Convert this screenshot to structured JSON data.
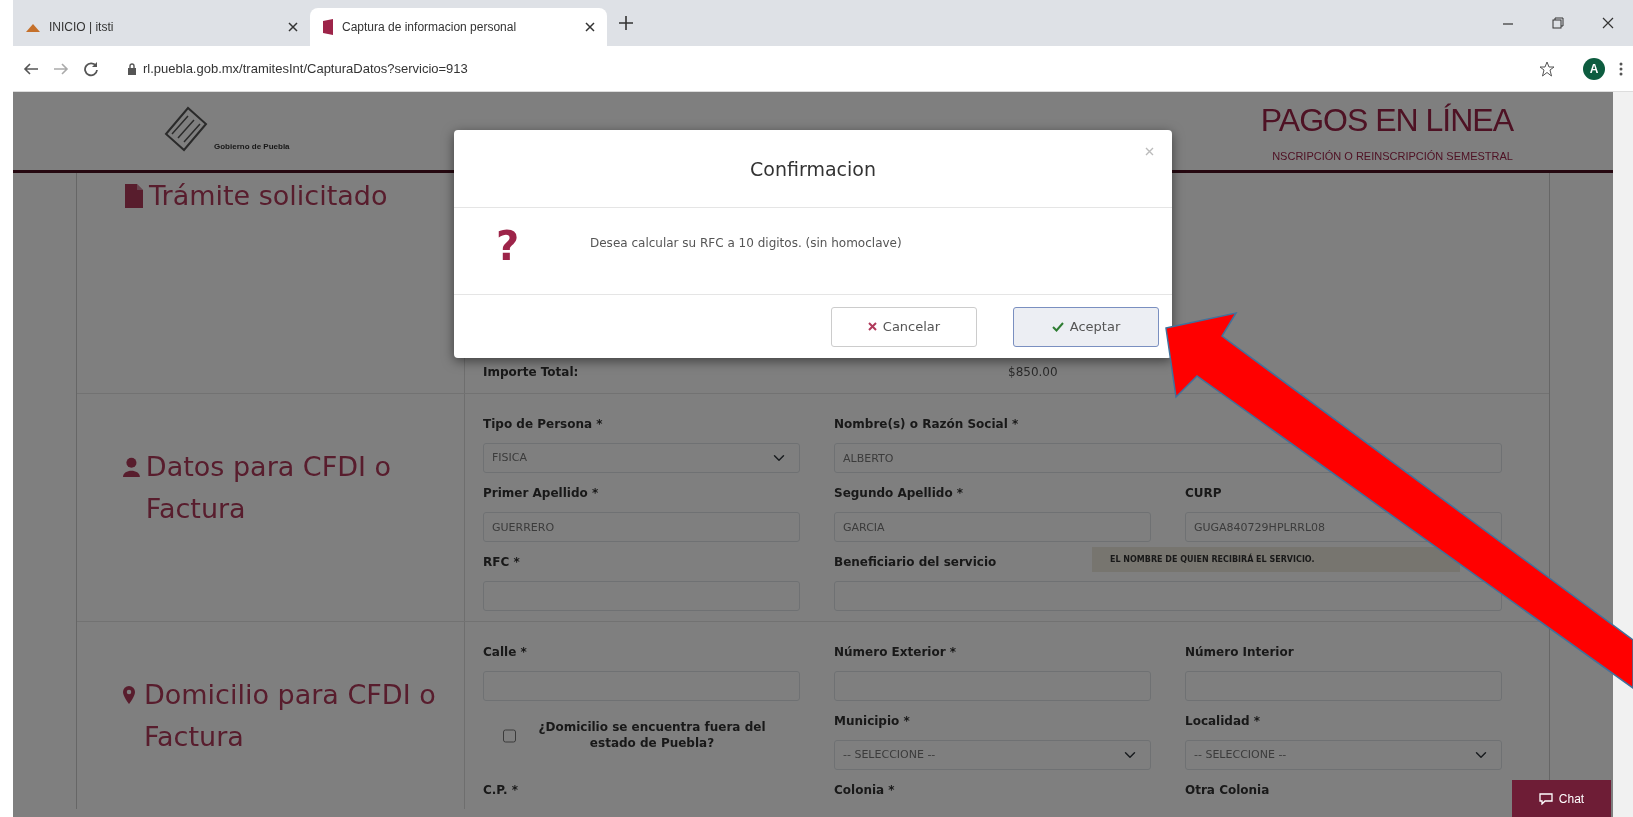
{
  "browser": {
    "tabs": [
      {
        "title": "INICIO | itsti",
        "selected": false
      },
      {
        "title": "Captura de informacion personal",
        "selected": true
      }
    ],
    "url": "rl.puebla.gob.mx/tramitesInt/CapturaDatos?servicio=913",
    "profile_initial": "A"
  },
  "header": {
    "logo_text": "Gobierno de Puebla",
    "title": "PAGOS EN LÍNEA",
    "subtitle": "NSCRIPCIÓN O REINSCRIPCIÓN SEMESTRAL"
  },
  "sections": [
    {
      "kind": "summary",
      "heading": "Trámite solicitado",
      "label": "Importe Total:",
      "value": "$850.00"
    },
    {
      "kind": "form",
      "heading": "Datos para CFDI o Factura",
      "rows": [
        [
          {
            "kind": "select",
            "label": "Tipo de Persona *",
            "value": "FISICA"
          },
          {
            "kind": "input",
            "label": "Nombre(s) o Razón Social *",
            "value": "ALBERTO",
            "wide": true
          }
        ],
        [
          {
            "kind": "input",
            "label": "Primer Apellido *",
            "value": "GUERRERO"
          },
          {
            "kind": "input",
            "label": "Segundo Apellido *",
            "value": "GARCIA"
          },
          {
            "kind": "input",
            "label": "CURP",
            "value": "GUGA840729HPLRRL08"
          }
        ],
        [
          {
            "kind": "input",
            "label": "RFC *"
          },
          {
            "kind": "input",
            "label": "Beneficiario del servicio",
            "wide": true,
            "hint": "EL NOMBRE DE QUIEN RECIBIRÁ EL SERVICIO."
          }
        ]
      ]
    },
    {
      "kind": "form",
      "heading": "Domicilio para CFDI o Factura",
      "rows": [
        [
          {
            "kind": "input",
            "label": "Calle *"
          },
          {
            "kind": "input",
            "label": "Número Exterior *"
          },
          {
            "kind": "input",
            "label": "Número Interior"
          }
        ],
        [
          {
            "kind": "checkbox",
            "label": "¿Domicilio se encuentra fuera del estado de Puebla?",
            "checked": false
          },
          {
            "kind": "select",
            "label": "Municipio *",
            "value": "-- SELECCIONE --"
          },
          {
            "kind": "select",
            "label": "Localidad *",
            "value": "-- SELECCIONE --"
          }
        ],
        [
          {
            "kind": "label",
            "label": "C.P. *"
          },
          {
            "kind": "label",
            "label": "Colonia *"
          },
          {
            "kind": "label",
            "label": "Otra Colonia"
          }
        ]
      ]
    }
  ],
  "chat_button": "Chat",
  "dialog": {
    "title": "Confirmacion",
    "symbol": "?",
    "message": "Desea calcular su RFC a 10 digitos. (sin homoclave)",
    "buttons": [
      {
        "kind": "cancel",
        "label": "Cancelar"
      },
      {
        "kind": "accept",
        "label": "Aceptar"
      }
    ]
  }
}
